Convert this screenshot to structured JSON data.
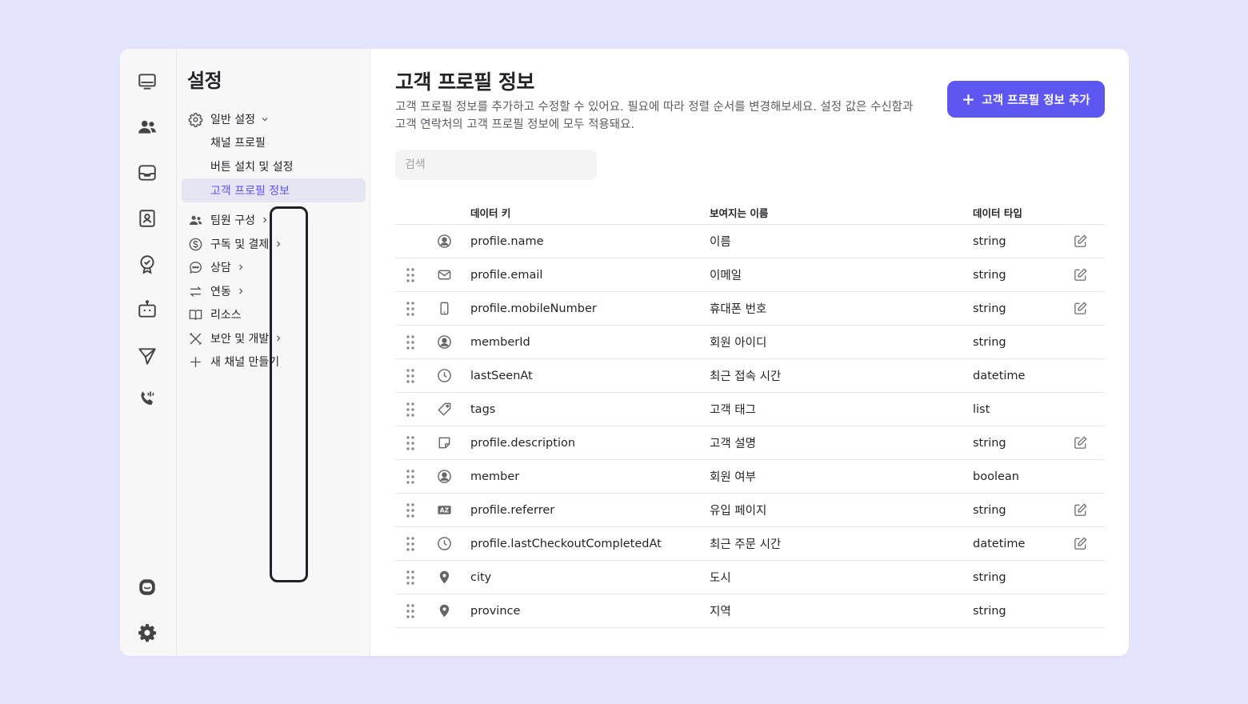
{
  "sidebar": {
    "title": "설정",
    "general": {
      "label": "일반 설정",
      "children": [
        {
          "label": "채널 프로필"
        },
        {
          "label": "버튼 설치 및 설정"
        },
        {
          "label": "고객 프로필 정보"
        }
      ]
    },
    "items": [
      {
        "label": "팀원 구성",
        "icon": "users-icon"
      },
      {
        "label": "구독 및 결제",
        "icon": "dollar-icon"
      },
      {
        "label": "상담",
        "icon": "chat-icon"
      },
      {
        "label": "연동",
        "icon": "swap-icon"
      },
      {
        "label": "리소스",
        "icon": "book-icon"
      },
      {
        "label": "보안 및 개발",
        "icon": "tools-icon"
      },
      {
        "label": "새 채널 만들기",
        "icon": "plus-icon"
      }
    ]
  },
  "main": {
    "title": "고객 프로필 정보",
    "description": "고객 프로필 정보를 추가하고 수정할 수 있어요. 필요에 따라 정렬 순서를 변경해보세요. 설정 값은 수신함과 고객 연락처의 고객 프로필 정보에 모두 적용돼요.",
    "add_button": "고객 프로필 정보 추가",
    "search_placeholder": "검색",
    "table": {
      "headers": {
        "key": "데이터 키",
        "name": "보여지는 이름",
        "type": "데이터 타입"
      },
      "rows": [
        {
          "key": "profile.name",
          "name": "이름",
          "type": "string",
          "icon": "user-circle-icon",
          "draggable": false,
          "editable": true
        },
        {
          "key": "profile.email",
          "name": "이메일",
          "type": "string",
          "icon": "mail-icon",
          "draggable": true,
          "editable": true
        },
        {
          "key": "profile.mobileNumber",
          "name": "휴대폰 번호",
          "type": "string",
          "icon": "phone-icon",
          "draggable": true,
          "editable": true
        },
        {
          "key": "memberId",
          "name": "회원 아이디",
          "type": "string",
          "icon": "user-circle-icon",
          "draggable": true,
          "editable": false
        },
        {
          "key": "lastSeenAt",
          "name": "최근 접속 시간",
          "type": "datetime",
          "icon": "clock-icon",
          "draggable": true,
          "editable": false
        },
        {
          "key": "tags",
          "name": "고객 태그",
          "type": "list",
          "icon": "tag-icon",
          "draggable": true,
          "editable": false
        },
        {
          "key": "profile.description",
          "name": "고객 설명",
          "type": "string",
          "icon": "note-icon",
          "draggable": true,
          "editable": true
        },
        {
          "key": "member",
          "name": "회원 여부",
          "type": "boolean",
          "icon": "user-circle-icon",
          "draggable": true,
          "editable": false
        },
        {
          "key": "profile.referrer",
          "name": "유입 페이지",
          "type": "string",
          "icon": "az-icon",
          "draggable": true,
          "editable": true
        },
        {
          "key": "profile.lastCheckoutCompletedAt",
          "name": "최근 주문 시간",
          "type": "datetime",
          "icon": "clock-icon",
          "draggable": true,
          "editable": true
        },
        {
          "key": "city",
          "name": "도시",
          "type": "string",
          "icon": "pin-icon",
          "draggable": true,
          "editable": false
        },
        {
          "key": "province",
          "name": "지역",
          "type": "string",
          "icon": "pin-icon",
          "draggable": true,
          "editable": false
        }
      ]
    }
  },
  "colors": {
    "accent": "#5e56f0",
    "page_bg": "#e3e3fd"
  }
}
